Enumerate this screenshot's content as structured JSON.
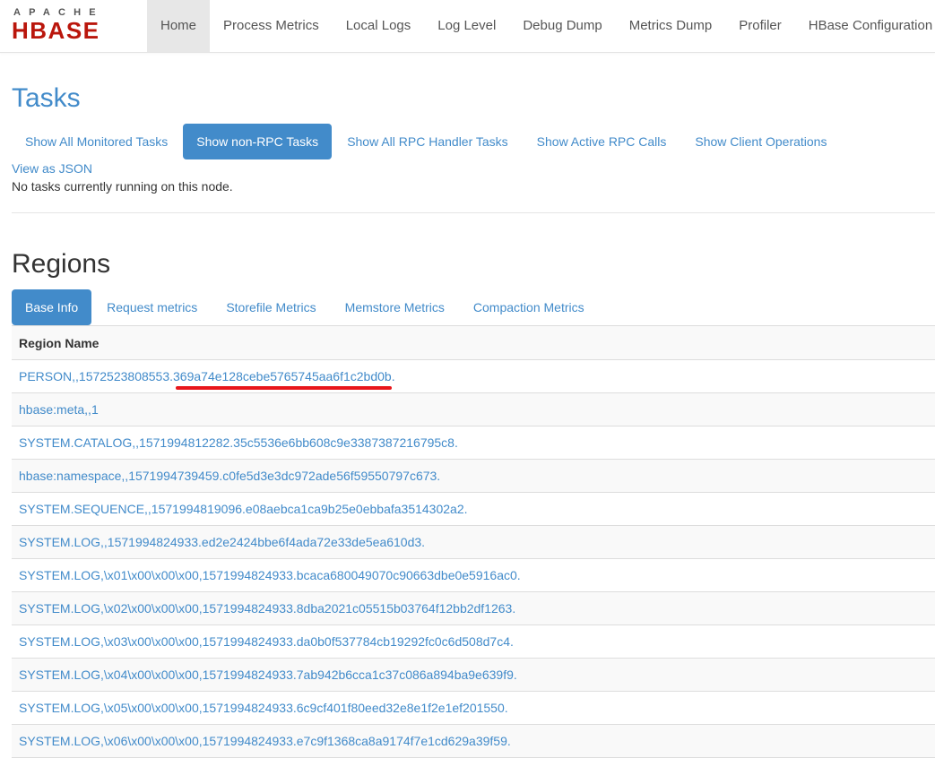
{
  "logo": {
    "top": "APACHE",
    "main": "HBASE"
  },
  "nav": {
    "items": [
      {
        "label": "Home",
        "active": true
      },
      {
        "label": "Process Metrics",
        "active": false
      },
      {
        "label": "Local Logs",
        "active": false
      },
      {
        "label": "Log Level",
        "active": false
      },
      {
        "label": "Debug Dump",
        "active": false
      },
      {
        "label": "Metrics Dump",
        "active": false
      },
      {
        "label": "Profiler",
        "active": false
      },
      {
        "label": "HBase Configuration",
        "active": false
      }
    ]
  },
  "tasks": {
    "title": "Tasks",
    "filters": [
      {
        "label": "Show All Monitored Tasks",
        "active": false
      },
      {
        "label": "Show non-RPC Tasks",
        "active": true
      },
      {
        "label": "Show All RPC Handler Tasks",
        "active": false
      },
      {
        "label": "Show Active RPC Calls",
        "active": false
      },
      {
        "label": "Show Client Operations",
        "active": false
      }
    ],
    "json_link": "View as JSON",
    "status": "No tasks currently running on this node."
  },
  "regions": {
    "title": "Regions",
    "tabs": [
      {
        "label": "Base Info",
        "active": true
      },
      {
        "label": "Request metrics",
        "active": false
      },
      {
        "label": "Storefile Metrics",
        "active": false
      },
      {
        "label": "Memstore Metrics",
        "active": false
      },
      {
        "label": "Compaction Metrics",
        "active": false
      }
    ],
    "column_header": "Region Name",
    "rows": [
      "PERSON,,1572523808553.369a74e128cebe5765745aa6f1c2bd0b.",
      "hbase:meta,,1",
      "SYSTEM.CATALOG,,1571994812282.35c5536e6bb608c9e3387387216795c8.",
      "hbase:namespace,,1571994739459.c0fe5d3e3dc972ade56f59550797c673.",
      "SYSTEM.SEQUENCE,,1571994819096.e08aebca1ca9b25e0ebbafa3514302a2.",
      "SYSTEM.LOG,,1571994824933.ed2e2424bbe6f4ada72e33de5ea610d3.",
      "SYSTEM.LOG,\\x01\\x00\\x00\\x00,1571994824933.bcaca680049070c90663dbe0e5916ac0.",
      "SYSTEM.LOG,\\x02\\x00\\x00\\x00,1571994824933.8dba2021c05515b03764f12bb2df1263.",
      "SYSTEM.LOG,\\x03\\x00\\x00\\x00,1571994824933.da0b0f537784cb19292fc0c6d508d7c4.",
      "SYSTEM.LOG,\\x04\\x00\\x00\\x00,1571994824933.7ab942b6cca1c37c086a894ba9e639f9.",
      "SYSTEM.LOG,\\x05\\x00\\x00\\x00,1571994824933.6c9cf401f80eed32e8e1f2e1ef201550.",
      "SYSTEM.LOG,\\x06\\x00\\x00\\x00,1571994824933.e7c9f1368ca8a9174f7e1cd629a39f59."
    ]
  },
  "colors": {
    "link": "#428bca",
    "active_pill": "#428bca",
    "logo_red": "#ba160c",
    "annotation_red": "#e8161b"
  }
}
